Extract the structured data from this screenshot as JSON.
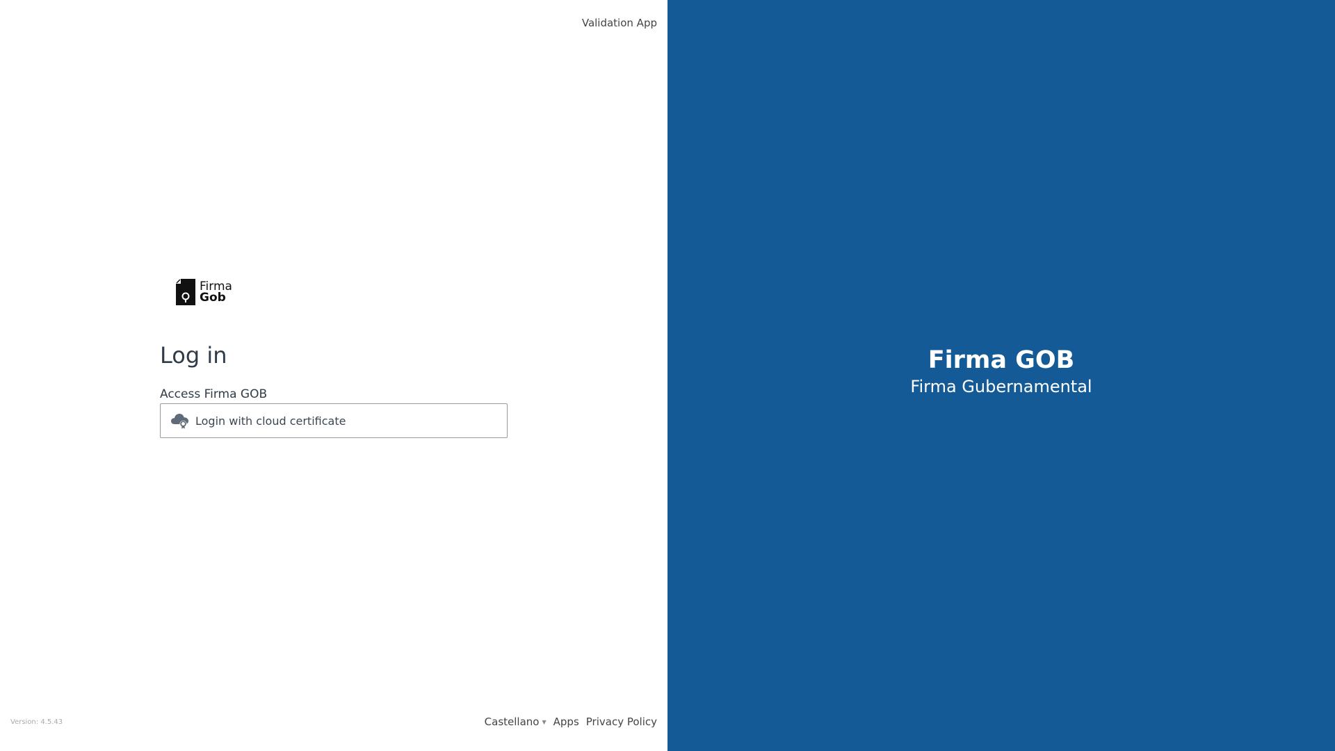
{
  "header": {
    "app_link": "Validation App"
  },
  "logo": {
    "line1": "Firma",
    "line2": "Gob"
  },
  "login": {
    "title": "Log in",
    "subtitle": "Access Firma GOB",
    "cloud_button_label": "Login with cloud certificate",
    "cloud_button_icon": "cloud-certificate-icon"
  },
  "footer": {
    "version": "Version: 4.5.43",
    "language": "Castellano",
    "apps": "Apps",
    "privacy": "Privacy Policy"
  },
  "brand": {
    "title": "Firma GOB",
    "subtitle": "Firma Gubernamental",
    "background_color": "#145a96"
  }
}
